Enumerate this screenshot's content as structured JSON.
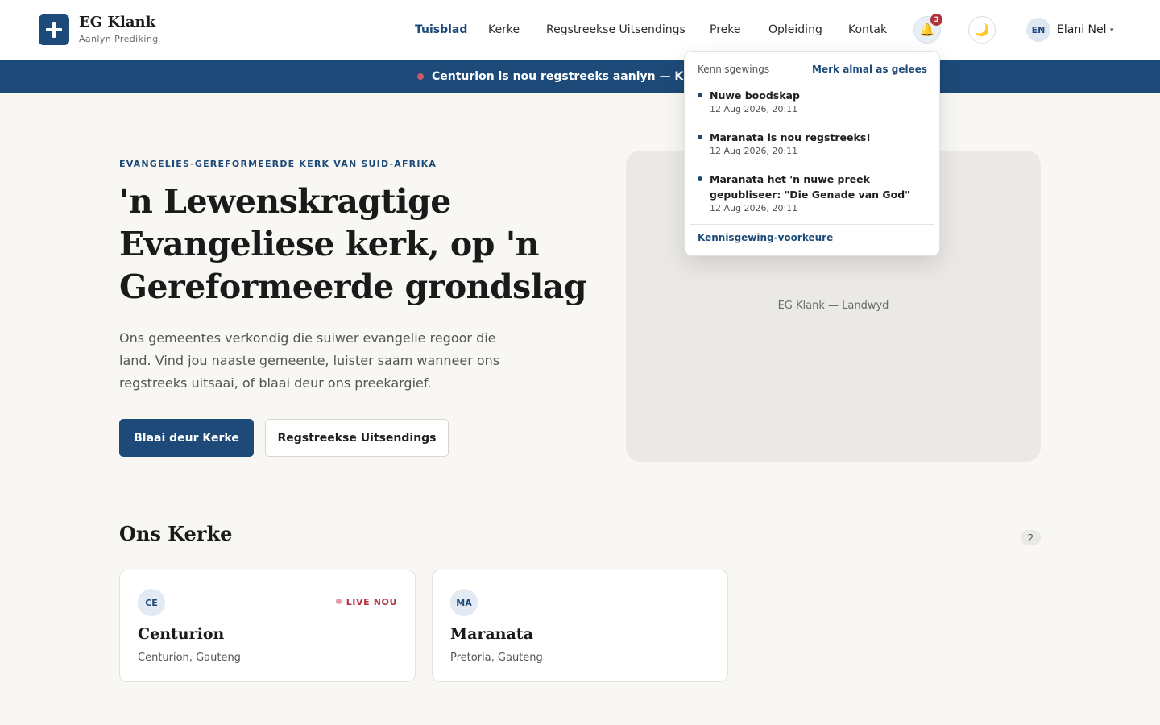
{
  "brand": {
    "name": "EG Klank",
    "tagline": "Aanlyn Prediking"
  },
  "nav": [
    {
      "label": "Tuisblad",
      "active": true
    },
    {
      "label": "Kerke"
    },
    {
      "label": "Regstreekse Uitsendings"
    },
    {
      "label": "Preke"
    },
    {
      "label": "Opleiding"
    },
    {
      "label": "Kontak"
    }
  ],
  "header": {
    "notification_count": "3",
    "bell_icon": "🔔",
    "theme_icon": "🌙",
    "user": {
      "initials": "EN",
      "name": "Elani Nel",
      "caret": "▾"
    }
  },
  "banner": {
    "text": "Centurion is nou regstreeks aanlyn — Kliek om in te skakel"
  },
  "hero": {
    "eyebrow": "EVANGELIES-GEREFORMEERDE KERK VAN SUID-AFRIKA",
    "title": "'n Lewenskragtige Evangeliese kerk, op 'n Gereformeerde grondslag",
    "description": "Ons gemeentes verkondig die suiwer evangelie regoor die land. Vind jou naaste gemeente, luister saam wanneer ons regstreeks uitsaai, of blaai deur ons preekargief.",
    "primary_button": "Blaai deur Kerke",
    "secondary_button": "Regstreekse Uitsendings",
    "image_caption": "EG Klank — Landwyd"
  },
  "notifications": {
    "heading": "Kennisgewings",
    "mark_all": "Merk almal as gelees",
    "items": [
      {
        "title": "Nuwe boodskap",
        "time": "12 Aug 2026, 20:11"
      },
      {
        "title": "Maranata is nou regstreeks!",
        "time": "12 Aug 2026, 20:11"
      },
      {
        "title": "Maranata het 'n nuwe preek gepubliseer: \"Die Genade van God\"",
        "time": "12 Aug 2026, 20:11"
      }
    ],
    "preferences": "Kennisgewing-voorkeure"
  },
  "churches": {
    "title": "Ons Kerke",
    "count": "2",
    "items": [
      {
        "initials": "CE",
        "name": "Centurion",
        "location": "Centurion, Gauteng",
        "live_label": "LIVE NOU"
      },
      {
        "initials": "MA",
        "name": "Maranata",
        "location": "Pretoria, Gauteng"
      }
    ]
  },
  "colors": {
    "primary": "#1d4a78",
    "live": "#b2313b",
    "background": "#f8f7f4"
  }
}
